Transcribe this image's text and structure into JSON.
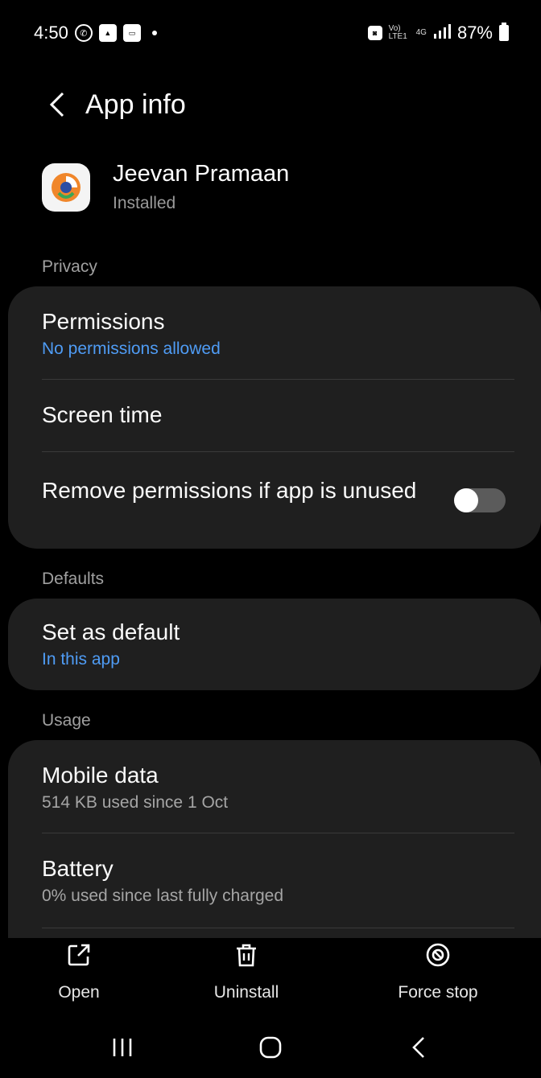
{
  "status_bar": {
    "time": "4:50",
    "signal_text": "Vo) LTE1",
    "network": "4G",
    "battery": "87%",
    "icons": [
      "whatsapp-icon",
      "gallery-icon",
      "paytm-icon",
      "dot-icon",
      "lock-icon",
      "signal-icon",
      "battery-icon"
    ]
  },
  "header": {
    "title": "App info"
  },
  "app": {
    "name": "Jeevan Pramaan",
    "status": "Installed"
  },
  "sections": {
    "privacy": "Privacy",
    "defaults": "Defaults",
    "usage": "Usage"
  },
  "privacy": {
    "permissions_title": "Permissions",
    "permissions_sub": "No permissions allowed",
    "screen_time": "Screen time",
    "remove_permissions": "Remove permissions if app is unused",
    "remove_permissions_enabled": false
  },
  "defaults": {
    "set_default_title": "Set as default",
    "set_default_sub": "In this app"
  },
  "usage": {
    "mobile_data_title": "Mobile data",
    "mobile_data_sub": "514 KB used since 1 Oct",
    "battery_title": "Battery",
    "battery_sub": "0% used since last fully charged"
  },
  "actions": {
    "open": "Open",
    "uninstall": "Uninstall",
    "force_stop": "Force stop"
  },
  "colors": {
    "background": "#000000",
    "card": "#1f1f1f",
    "accent_blue": "#4f9cf5",
    "secondary_text": "#a5a5a5"
  }
}
